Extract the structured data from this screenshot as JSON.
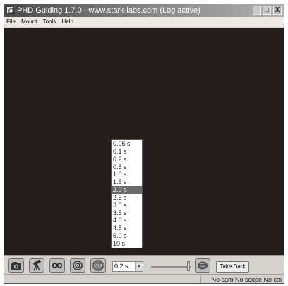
{
  "window": {
    "title": "PHD Guiding 1.7.0  -  www.stark-labs.com (Log active)",
    "minimize_glyph": "_",
    "maximize_glyph": "□",
    "close_glyph": "X"
  },
  "menu": {
    "items": [
      {
        "label": "File"
      },
      {
        "label": "Mount"
      },
      {
        "label": "Tools"
      },
      {
        "label": "Help"
      }
    ]
  },
  "toolbar": {
    "buttons": [
      {
        "icon": "camera-icon"
      },
      {
        "icon": "telescope-icon"
      },
      {
        "icon": "loop-icon"
      },
      {
        "icon": "target-icon"
      },
      {
        "icon": "stop-icon",
        "label": "STOP"
      }
    ],
    "exposure_value": "0.2 s",
    "exposure_arrow": "▼",
    "brain_icon": "brain-icon",
    "take_dark_label": "Take Dark"
  },
  "exposure_dropdown": {
    "options": [
      "0.05 s",
      "0.1 s",
      "0.2 s",
      "0.5 s",
      "1.0 s",
      "1.5 s",
      "2.0 s",
      "2.5 s",
      "3.0 s",
      "3.5 s",
      "4.0 s",
      "4.5 s",
      "5.0 s",
      "10 s"
    ],
    "highlighted": "2.0 s"
  },
  "status": {
    "text": "No cam  No scope  No cal"
  },
  "colors": {
    "display_background": "#231e1c",
    "highlight": "#6b6b6b"
  }
}
